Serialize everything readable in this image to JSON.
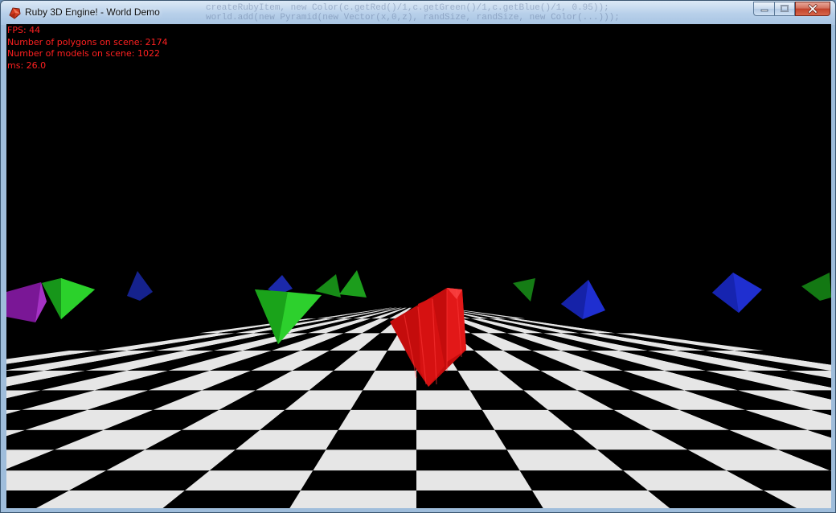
{
  "window": {
    "title": "Ruby 3D Engine! - World Demo",
    "background_code": "createRubyItem, new Color(c.getRed()/1,c.getGreen()/1,c.getBlue()/1, 0.95));\nworld.add(new Pyramid(new Vector(x,0,z), randSize, randSize, new Color(...)));",
    "controls": {
      "minimize": "minimize",
      "maximize": "maximize",
      "close": "close"
    }
  },
  "hud": {
    "fps": "FPS: 44",
    "polygons": "Number of polygons on scene: 2174",
    "models": "Number of models on scene: 1022",
    "ms": "ms: 26.0"
  },
  "scene": {
    "background_color": "#000000",
    "tile_light": "#e6e6e6",
    "tile_dark": "#000000",
    "hud_color": "#ff2020",
    "objects": [
      {
        "name": "purple-pyramid",
        "color": "#8b1fa8"
      },
      {
        "name": "green-pyramid",
        "color": "#1fbf1f"
      },
      {
        "name": "blue-pyramid",
        "color": "#1f2fd0"
      },
      {
        "name": "red-gem",
        "color": "#e01010"
      }
    ]
  }
}
